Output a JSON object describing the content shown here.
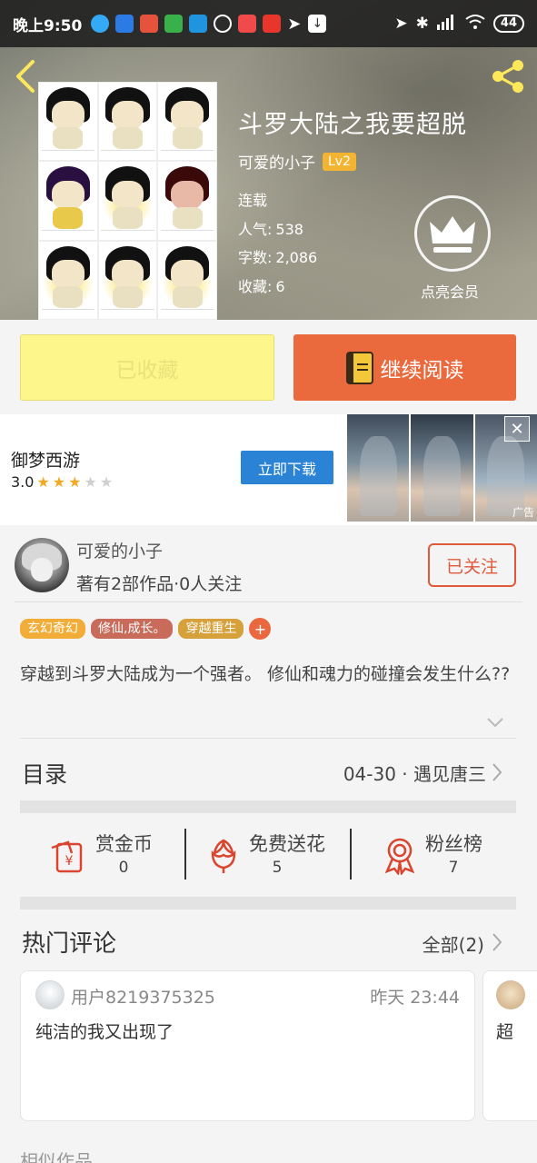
{
  "status_bar": {
    "time": "晚上9:50",
    "battery": "44",
    "colors": {
      "app_icons": [
        "#34a9f5",
        "#2c7be5",
        "#e6533c",
        "#39b14a",
        "#1f95e0",
        "#ffffff",
        "#f04a4a",
        "#e8362c"
      ]
    }
  },
  "header": {
    "title": "斗罗大陆之我要超脱",
    "author": "可爱的小子",
    "level": "Lv2",
    "status": "连载",
    "popularity_label": "人气:",
    "popularity": "538",
    "words_label": "字数:",
    "words": "2,086",
    "favorites_label": "收藏:",
    "favorites": "6",
    "vip_label": "点亮会员",
    "icons": {
      "back": "back-arrow-icon",
      "share": "share-icon",
      "vip": "crown-icon"
    }
  },
  "actions": {
    "collected_label": "已收藏",
    "read_label": "继续阅读"
  },
  "ad": {
    "name": "御梦西游",
    "rating": "3.0",
    "stars_on": 3,
    "stars_total": 5,
    "download_label": "立即下载",
    "tag": "广告"
  },
  "author_card": {
    "name": "可爱的小子",
    "desc": "著有2部作品·0人关注",
    "follow_label": "已关注"
  },
  "tags": [
    {
      "label": "玄幻奇幻",
      "color": "#f2ad38"
    },
    {
      "label": "修仙,成长。",
      "color": "#c96b5a"
    },
    {
      "label": "穿越重生",
      "color": "#d6a13a"
    }
  ],
  "tag_add": "+",
  "description": "穿越到斗罗大陆成为一个强者。 修仙和魂力的碰撞会发生什么??",
  "catalog": {
    "title": "目录",
    "latest": "04-30 · 遇见唐三"
  },
  "gifts": [
    {
      "label": "赏金币",
      "count": "0",
      "icon": "coin-envelope-icon"
    },
    {
      "label": "免费送花",
      "count": "5",
      "icon": "flower-icon"
    },
    {
      "label": "粉丝榜",
      "count": "7",
      "icon": "rank-medal-icon"
    }
  ],
  "comments": {
    "title": "热门评论",
    "all_label": "全部(2)",
    "items": [
      {
        "user": "用户8219375325",
        "time": "昨天 23:44",
        "text": "纯洁的我又出现了"
      },
      {
        "text": "超"
      }
    ]
  },
  "similar_title": "相似作品",
  "colors": {
    "accent": "#ea6a3e",
    "collected_bg": "#fdf78b",
    "ad_button": "#2b83d6"
  }
}
